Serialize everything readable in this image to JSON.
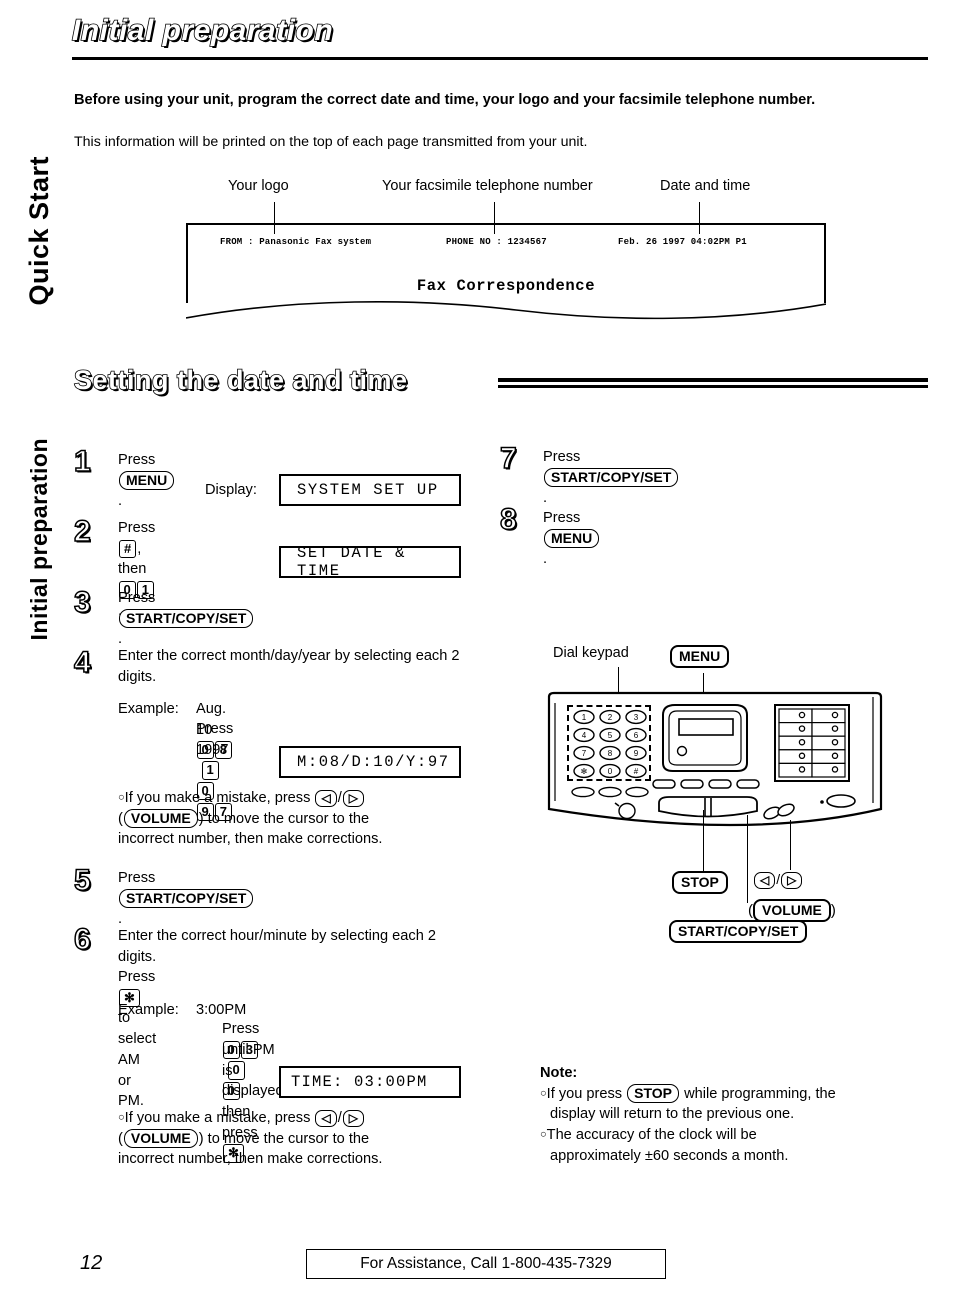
{
  "page": {
    "title": "Initial preparation",
    "number": "12",
    "assistance": "For Assistance, Call 1-800-435-7329"
  },
  "side_tabs": {
    "quick_start": "Quick Start",
    "initial_preparation": "Initial preparation"
  },
  "intro": {
    "bold": "Before using your unit, program the correct date and time, your logo and your facsimile telephone number.",
    "plain": "This information will be printed on the top of each page transmitted from your unit."
  },
  "fax_sample": {
    "callouts": {
      "logo": "Your logo",
      "phone": "Your facsimile telephone number",
      "datetime": "Date and time"
    },
    "header": {
      "from": "FROM : Panasonic Fax system",
      "phone_no": "PHONE NO : 1234567",
      "datetime": "Feb. 26 1997 04:02PM P1"
    },
    "body_title": "Fax Correspondence"
  },
  "section": {
    "heading": "Setting the date and time"
  },
  "steps": {
    "s1": {
      "num": "1",
      "text_before": "Press ",
      "key": "MENU",
      "text_after": ".",
      "display_label": "Display:",
      "display_value": "SYSTEM SET UP"
    },
    "s2": {
      "num": "2",
      "text_before": "Press ",
      "key_hash": "#",
      "text_mid": ", then ",
      "key_0": "0",
      "key_1": "1",
      "text_after": ".",
      "display_value": "SET DATE & TIME"
    },
    "s3": {
      "num": "3",
      "text_before": "Press ",
      "key": "START/COPY/SET",
      "text_after": "."
    },
    "s4": {
      "num": "4",
      "instruction": "Enter the correct month/day/year by selecting each 2 digits.",
      "example_label": "Example:",
      "example_value": "Aug. 10 1997",
      "press_label": "Press ",
      "press_keys": [
        "0",
        "8",
        "1",
        "0",
        "9",
        "7"
      ],
      "press_after": ".",
      "display_value": "M:08/D:10/Y:97",
      "note_a": "If you make a mistake, press ",
      "note_arrow_left": "◁",
      "note_slash": "/",
      "note_arrow_right": "▷",
      "note_b_open": "(",
      "note_volume": "VOLUME",
      "note_b_close": ") to move the cursor to the",
      "note_c": "incorrect number, then make corrections."
    },
    "s5": {
      "num": "5",
      "text_before": "Press ",
      "key": "START/COPY/SET",
      "text_after": "."
    },
    "s6": {
      "num": "6",
      "instruction": "Enter the correct hour/minute by selecting each 2 digits.",
      "instruction2_before": "Press ",
      "instruction2_key": "✻",
      "instruction2_after": " to select AM or PM.",
      "example_label": "Example:",
      "example_value": "3:00PM",
      "press_label": "Press ",
      "press_keys": [
        "0",
        "3",
        "0",
        "0"
      ],
      "press_mid": ", then press ",
      "press_star": "✻",
      "press_tail": "until PM is displayed.",
      "display_value": "TIME:    03:00PM",
      "note_a": "If you make a mistake, press ",
      "note_arrow_left": "◁",
      "note_slash": "/",
      "note_arrow_right": "▷",
      "note_b_open": "(",
      "note_volume": "VOLUME",
      "note_b_close": ") to move the cursor to the",
      "note_c": "incorrect number, then make corrections."
    },
    "s7": {
      "num": "7",
      "text_before": "Press ",
      "key": "START/COPY/SET",
      "text_after": "."
    },
    "s8": {
      "num": "8",
      "text_before": "Press ",
      "key": "MENU",
      "text_after": "."
    }
  },
  "machine": {
    "label_keypad": "Dial keypad",
    "key_menu": "MENU",
    "key_stop": "STOP",
    "key_left": "◁",
    "key_slash": "/",
    "key_right": "▷",
    "key_volume": "VOLUME",
    "volume_open": "(",
    "volume_close": ")",
    "key_start": "START/COPY/SET",
    "keypad_digits": [
      "1",
      "2",
      "3",
      "4",
      "5",
      "6",
      "7",
      "8",
      "9",
      "✻",
      "0",
      "#"
    ]
  },
  "note": {
    "title": "Note:",
    "item1_a": "If you press ",
    "item1_key": "STOP",
    "item1_b": " while programming, the",
    "item1_c": "display will return to the previous one.",
    "item2_a": "The accuracy of the clock will be",
    "item2_b": "approximately ±60 seconds a month."
  }
}
